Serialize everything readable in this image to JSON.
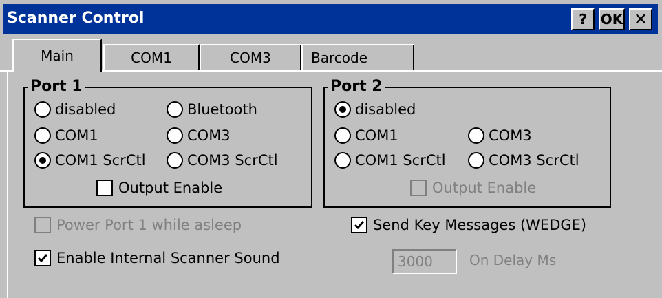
{
  "window": {
    "title": "Scanner Control",
    "help_label": "?",
    "ok_label": "OK",
    "close_label": "✕"
  },
  "tabs": [
    "Main",
    "COM1",
    "COM3",
    "Barcode"
  ],
  "port1": {
    "legend": "Port 1",
    "options": [
      "disabled",
      "Bluetooth",
      "COM1",
      "COM3",
      "COM1 ScrCtl",
      "COM3 ScrCtl"
    ],
    "selected": "COM1 ScrCtl",
    "output_enable_label": "Output Enable",
    "output_enable_checked": false
  },
  "port2": {
    "legend": "Port 2",
    "options": [
      "disabled",
      "COM1",
      "COM3",
      "COM1 ScrCtl",
      "COM3 ScrCtl"
    ],
    "selected": "disabled",
    "output_enable_label": "Output Enable",
    "output_enable_checked": false
  },
  "power_port1": {
    "label": "Power Port 1 while asleep",
    "checked": false,
    "enabled": false
  },
  "scanner_sound": {
    "label": "Enable Internal Scanner Sound",
    "checked": true
  },
  "wedge": {
    "label": "Send Key Messages (WEDGE)",
    "checked": true
  },
  "on_delay": {
    "value": "3000",
    "label": "On Delay Ms"
  },
  "colors": {
    "titlebar": "#003399",
    "face": "#c0c0c0",
    "disabled_text": "#808080"
  }
}
